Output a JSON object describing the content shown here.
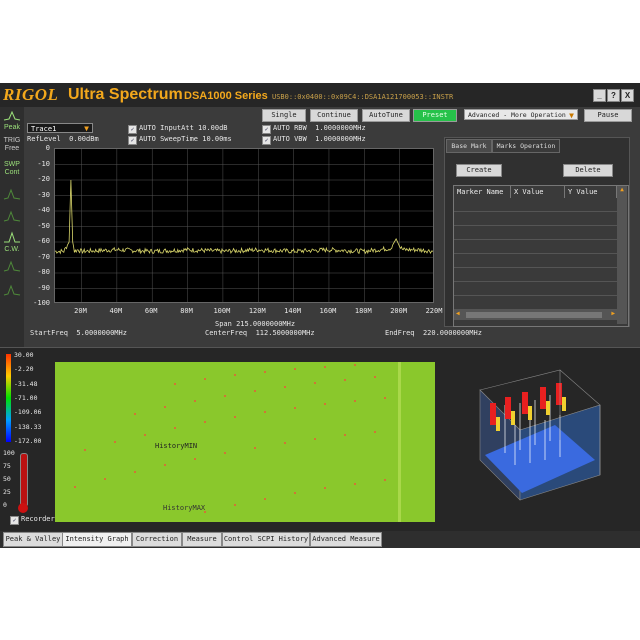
{
  "window": {
    "brand": "RIGOL",
    "product": "Ultra Spectrum",
    "series": "DSA1000 Series",
    "usb_info": "USB0::0x0400::0x09C4::DSA1A121700053::INSTR",
    "controls": [
      "_",
      "?",
      "X"
    ]
  },
  "sidebar": [
    {
      "label": "Peak",
      "icon": "peak-icon"
    },
    {
      "label": "TRIG Free",
      "icon": "trigger-icon"
    },
    {
      "label": "SWP Cont",
      "icon": "sweep-icon"
    },
    {
      "label": "",
      "icon": "waveform-icon"
    },
    {
      "label": "",
      "icon": "waveform-icon"
    },
    {
      "label": "C.W.",
      "icon": "cw-icon"
    },
    {
      "label": "",
      "icon": "waveform-icon"
    },
    {
      "label": "",
      "icon": "waveform-icon"
    }
  ],
  "toolbar": {
    "single": "Single",
    "continue": "Continue",
    "autotune": "AutoTune",
    "preset": "Preset",
    "advanced": "Advanced - More Operation",
    "pause": "Pause"
  },
  "settings": {
    "trace": "Trace1",
    "ref_level_label": "RefLevel",
    "ref_level": "0.00dBm",
    "auto_inputatt": "AUTO InputAtt",
    "inputatt_value": "10.00dB",
    "auto_sweeptime": "AUTO SweepTime",
    "sweeptime_value": "10.00ms",
    "auto_rbw": "AUTO RBW",
    "rbw_value": "1.0000000MHz",
    "auto_vbw": "AUTO VBW",
    "vbw_value": "1.0000000MHz"
  },
  "chart_data": {
    "type": "line",
    "ylim": [
      -100,
      0
    ],
    "y_ticks": [
      "0",
      "-10",
      "-20",
      "-30",
      "-40",
      "-50",
      "-60",
      "-70",
      "-80",
      "-90",
      "-100"
    ],
    "x_ticks": [
      "20M",
      "40M",
      "60M",
      "80M",
      "100M",
      "120M",
      "140M",
      "160M",
      "180M",
      "200M",
      "220M"
    ],
    "xlim": [
      5,
      220
    ],
    "series": [
      {
        "color": "#d9d66b",
        "x": [
          5,
          10,
          13,
          14,
          15,
          16,
          18,
          20,
          40,
          60,
          80,
          100,
          120,
          140,
          160,
          180,
          195,
          198,
          200,
          202,
          210,
          220
        ],
        "y": [
          -66,
          -66,
          -60,
          -20,
          -60,
          -66,
          -65,
          -66,
          -65,
          -66,
          -65,
          -66,
          -65,
          -66,
          -65,
          -66,
          -64,
          -58,
          -63,
          -65,
          -65,
          -66
        ]
      }
    ],
    "grid": true
  },
  "freq_info": {
    "start_label": "StartFreq",
    "start": "5.0000000MHz",
    "span_label": "Span",
    "span": "215.0000000MHz",
    "center_label": "CenterFreq",
    "center": "112.5000000MHz",
    "end_label": "EndFreq",
    "end": "220.0000000MHz"
  },
  "marker_panel": {
    "tab_base": "Base Mark",
    "tab_ops": "Marks Operation",
    "create": "Create",
    "delete": "Delete",
    "columns": [
      "Marker Name",
      "X Value",
      "Y Value"
    ]
  },
  "intensity": {
    "scale": [
      "30.00",
      "-2.20",
      "-31.48",
      "-71.00",
      "-109.06",
      "-138.33",
      "-172.00"
    ],
    "history_min": "HistoryMIN",
    "history_max": "HistoryMAX",
    "recorder_ticks": [
      "100",
      "75",
      "50",
      "25",
      "0"
    ],
    "recorder": "Recorder"
  },
  "bottom_tabs": [
    "Peak & Valley",
    "Intensity Graph",
    "Correction",
    "Measure",
    "Control SCPI History",
    "Advanced Measure"
  ]
}
